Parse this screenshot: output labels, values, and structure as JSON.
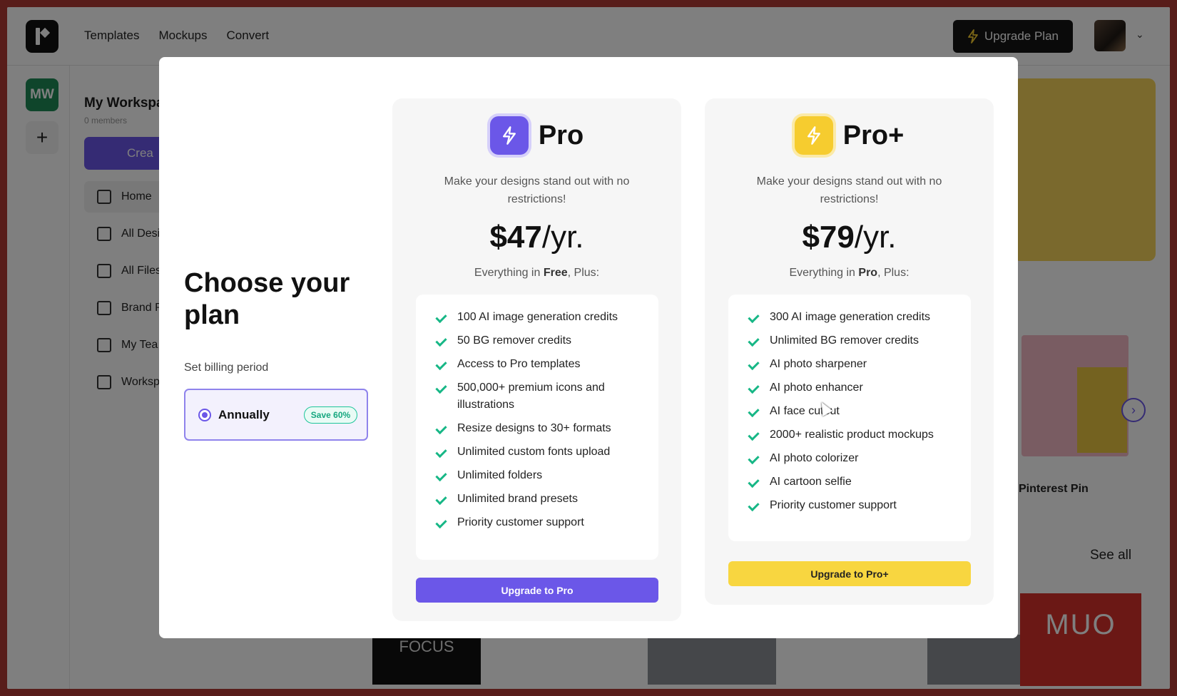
{
  "nav": {
    "items": [
      "Templates",
      "Mockups",
      "Convert"
    ],
    "upgrade_label": "Upgrade Plan"
  },
  "workspace": {
    "badge": "MW",
    "title": "My Workspa",
    "members": "0 members",
    "create_label": "Crea",
    "sidebar_items": [
      "Home",
      "All Desi",
      "All Files",
      "Brand P",
      "My Tea",
      "Worksp"
    ]
  },
  "background": {
    "card_label": "Pinterest Pin",
    "see_all": "See all",
    "thumb_text": "FOCUS",
    "brand_text": "MUO"
  },
  "modal": {
    "title": "Choose your plan",
    "billing_label": "Set billing period",
    "billing_option": "Annually",
    "save_badge": "Save 60%"
  },
  "plans": [
    {
      "name": "Pro",
      "description": "Make your designs stand out with no restrictions!",
      "price": "$47",
      "period": "/yr.",
      "includes_prefix": "Everything in ",
      "includes_tier": "Free",
      "includes_suffix": ", Plus:",
      "features": [
        "100 AI image generation credits",
        "50 BG remover credits",
        "Access to Pro templates",
        "500,000+ premium icons and illustrations",
        "Resize designs to 30+ formats",
        "Unlimited custom fonts upload",
        "Unlimited folders",
        "Unlimited brand presets",
        "Priority customer support"
      ],
      "cta": "Upgrade to Pro",
      "accent": "#6b57e8"
    },
    {
      "name": "Pro+",
      "description": "Make your designs stand out with no restrictions!",
      "price": "$79",
      "period": "/yr.",
      "includes_prefix": "Everything in ",
      "includes_tier": "Pro",
      "includes_suffix": ", Plus:",
      "features": [
        "300 AI image generation credits",
        "Unlimited BG remover credits",
        "AI photo sharpener",
        "AI photo enhancer",
        "AI face cutout",
        "2000+ realistic product mockups",
        "AI photo colorizer",
        "AI cartoon selfie",
        "Priority customer support"
      ],
      "cta": "Upgrade to Pro+",
      "accent": "#f6cc2f"
    }
  ]
}
